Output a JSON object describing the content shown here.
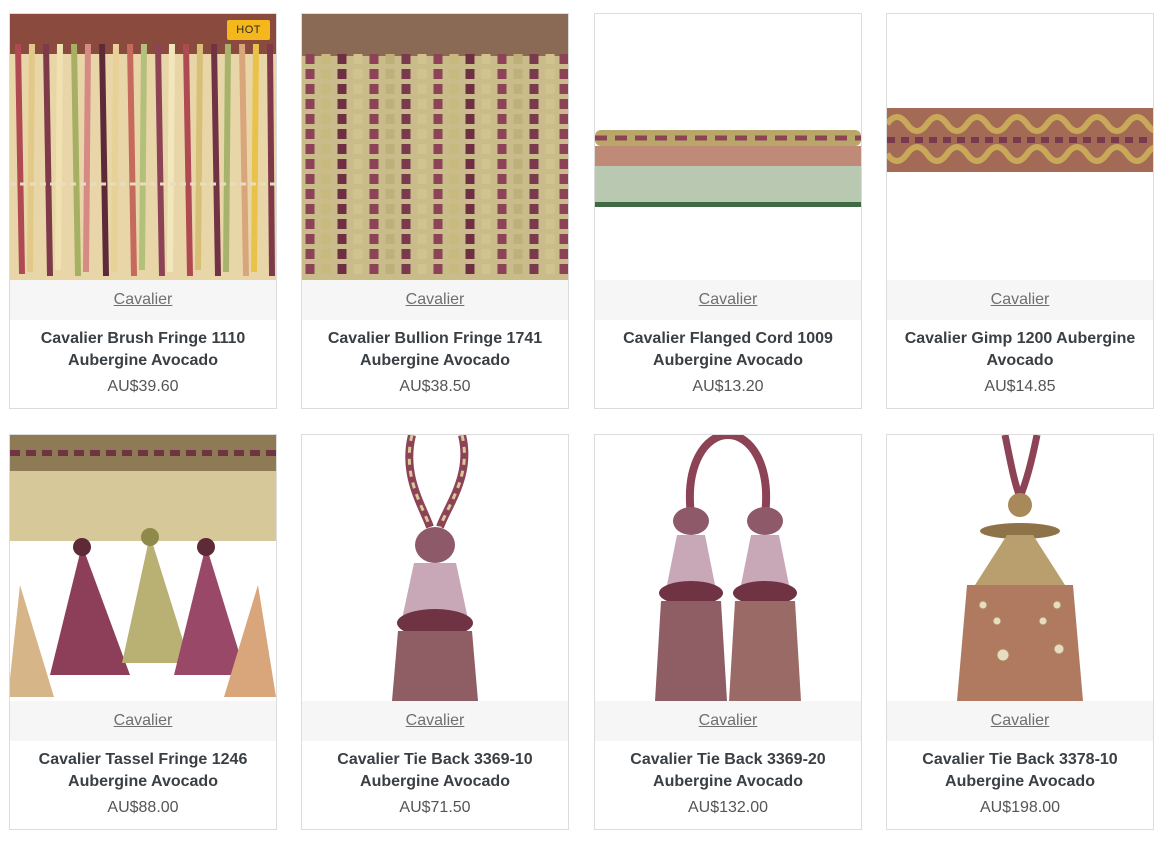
{
  "badge": {
    "hot": "HOT"
  },
  "products": [
    {
      "brand": "Cavalier",
      "title_line1": "Cavalier Brush Fringe 1110",
      "title_line2": "Aubergine Avocado",
      "price": "AU$39.60"
    },
    {
      "brand": "Cavalier",
      "title_line1": "Cavalier Bullion Fringe 1741",
      "title_line2": "Aubergine Avocado",
      "price": "AU$38.50"
    },
    {
      "brand": "Cavalier",
      "title_line1": "Cavalier Flanged Cord 1009",
      "title_line2": "Aubergine Avocado",
      "price": "AU$13.20"
    },
    {
      "brand": "Cavalier",
      "title_line1": "Cavalier Gimp 1200 Aubergine",
      "title_line2": "Avocado",
      "price": "AU$14.85"
    },
    {
      "brand": "Cavalier",
      "title_line1": "Cavalier Tassel Fringe 1246",
      "title_line2": "Aubergine Avocado",
      "price": "AU$88.00"
    },
    {
      "brand": "Cavalier",
      "title_line1": "Cavalier Tie Back 3369-10",
      "title_line2": "Aubergine Avocado",
      "price": "AU$71.50"
    },
    {
      "brand": "Cavalier",
      "title_line1": "Cavalier Tie Back 3369-20",
      "title_line2": "Aubergine Avocado",
      "price": "AU$132.00"
    },
    {
      "brand": "Cavalier",
      "title_line1": "Cavalier Tie Back 3378-10",
      "title_line2": "Aubergine Avocado",
      "price": "AU$198.00"
    }
  ],
  "colors": {
    "badge": "#f5b81c",
    "aubergine": "#7a3a4e",
    "avocado": "#b5a66a"
  }
}
